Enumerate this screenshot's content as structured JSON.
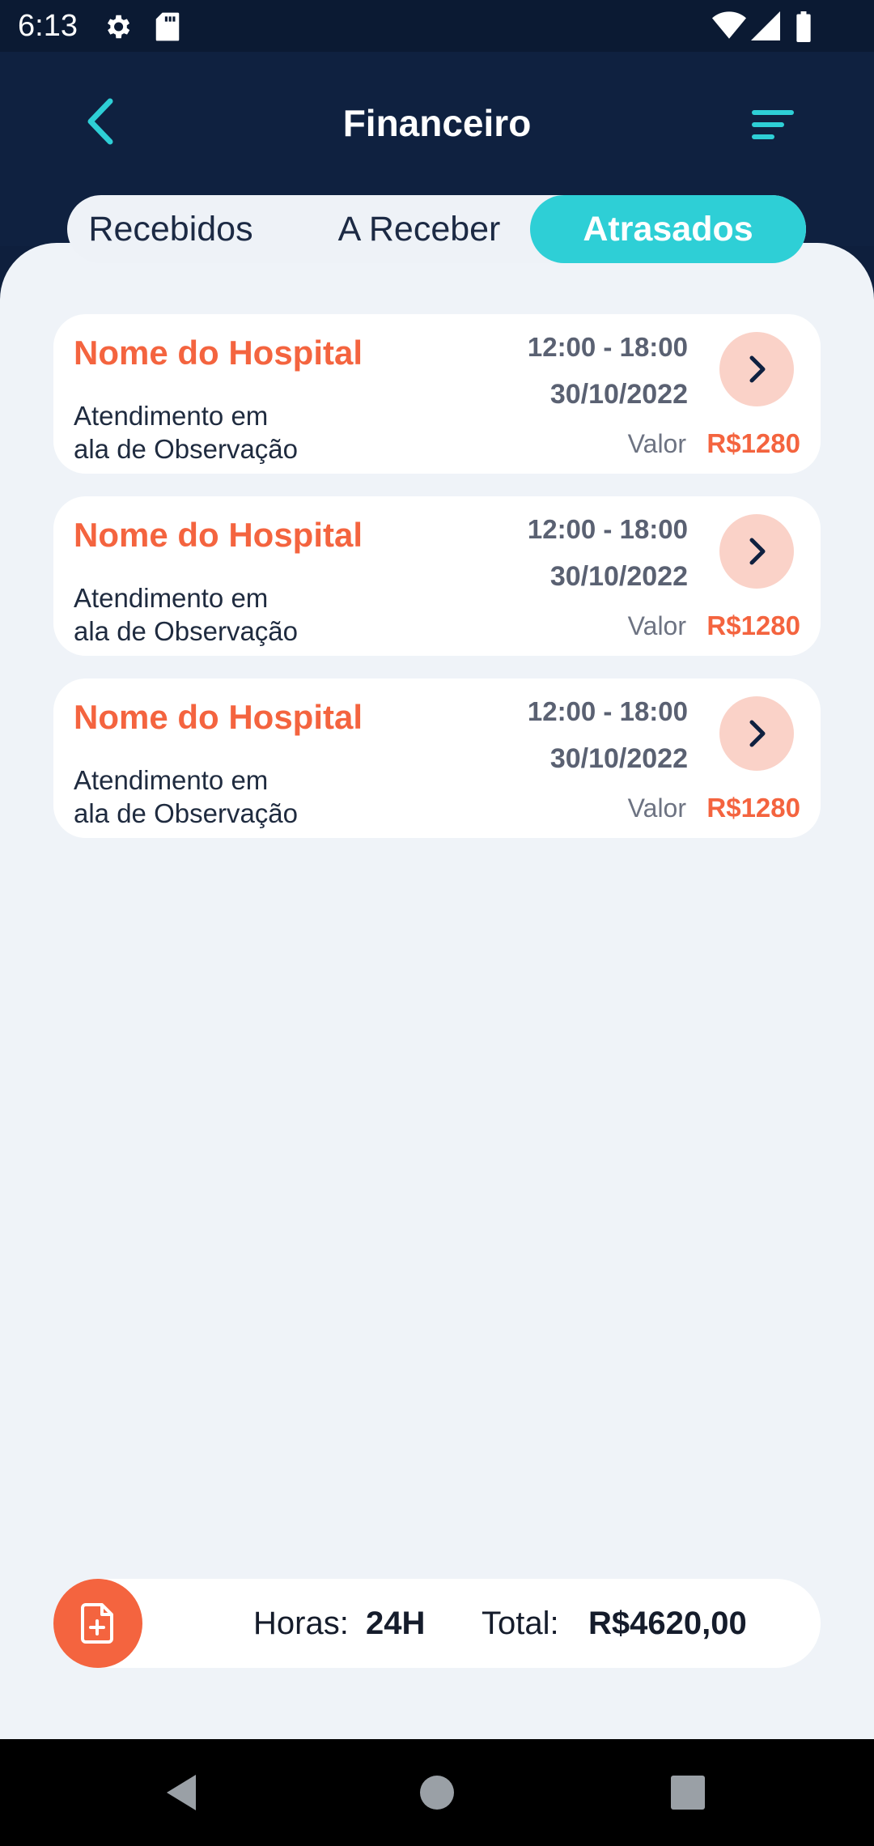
{
  "status_bar": {
    "time": "6:13",
    "icons": [
      "settings-icon",
      "sd-card-icon",
      "wifi-icon",
      "signal-icon",
      "battery-icon"
    ]
  },
  "header": {
    "title": "Financeiro",
    "back_icon": "chevron-left-icon",
    "filter_icon": "filter-lines-icon"
  },
  "tabs": [
    {
      "label": "Recebidos",
      "active": false
    },
    {
      "label": "A Receber",
      "active": false
    },
    {
      "label": "Atrasados",
      "active": true
    }
  ],
  "cards": [
    {
      "hospital": "Nome do Hospital",
      "time": "12:00 - 18:00",
      "date": "30/10/2022",
      "desc_line1": "Atendimento em",
      "desc_line2": "ala de Observação",
      "valor_label": "Valor",
      "amount": "R$1280"
    },
    {
      "hospital": "Nome do Hospital",
      "time": "12:00 - 18:00",
      "date": "30/10/2022",
      "desc_line1": "Atendimento em",
      "desc_line2": "ala de Observação",
      "valor_label": "Valor",
      "amount": "R$1280"
    },
    {
      "hospital": "Nome do Hospital",
      "time": "12:00 - 18:00",
      "date": "30/10/2022",
      "desc_line1": "Atendimento em",
      "desc_line2": "ala de Observação",
      "valor_label": "Valor",
      "amount": "R$1280"
    }
  ],
  "summary": {
    "hours_label": "Horas:",
    "hours_value": "24H",
    "total_label": "Total:",
    "total_value": "R$4620,00",
    "report_icon": "file-plus-icon"
  },
  "navigation": {
    "icons": [
      "back-triangle-icon",
      "home-circle-icon",
      "recents-square-icon"
    ]
  },
  "colors": {
    "header_bg": "#0f2140",
    "accent_teal": "#2ecfd6",
    "accent_orange": "#f4643f",
    "content_bg": "#eff3f8"
  }
}
